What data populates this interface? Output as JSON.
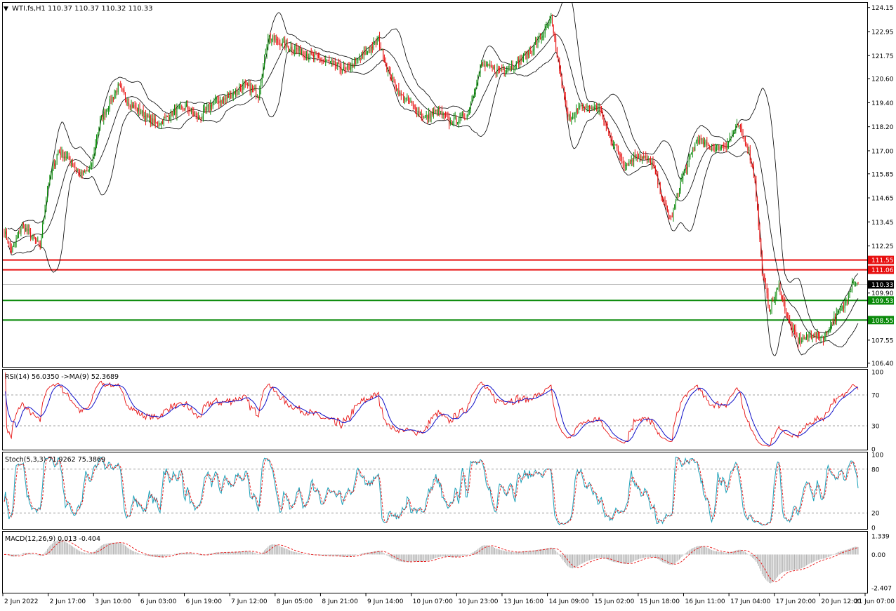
{
  "header": {
    "symbol": "WTI.fs,H1",
    "ohlc": "110.37 110.37 110.32 110.33"
  },
  "price_axis": {
    "ticks": [
      "124.15",
      "122.95",
      "121.75",
      "120.60",
      "119.40",
      "118.20",
      "117.00",
      "115.85",
      "114.65",
      "113.45",
      "112.25",
      "109.90",
      "107.55",
      "106.40"
    ],
    "tick_values": [
      124.15,
      122.95,
      121.75,
      120.6,
      119.4,
      118.2,
      117.0,
      115.85,
      114.65,
      113.45,
      112.25,
      109.9,
      107.55,
      106.4
    ],
    "range": [
      106.25,
      124.35
    ]
  },
  "levels": [
    {
      "label": "111.55",
      "value": 111.55,
      "color": "#e81010"
    },
    {
      "label": "111.06",
      "value": 111.06,
      "color": "#e81010"
    },
    {
      "label": "109.53",
      "value": 109.53,
      "color": "#0a8a0a"
    },
    {
      "label": "108.55",
      "value": 108.55,
      "color": "#0a8a0a"
    }
  ],
  "current_price": {
    "label": "110.33",
    "value": 110.33
  },
  "time_axis": [
    "2 Jun 2022",
    "2 Jun 17:00",
    "3 Jun 10:00",
    "6 Jun 03:00",
    "6 Jun 19:00",
    "7 Jun 12:00",
    "8 Jun 05:00",
    "8 Jun 21:00",
    "9 Jun 14:00",
    "10 Jun 07:00",
    "10 Jun 23:00",
    "13 Jun 16:00",
    "14 Jun 09:00",
    "15 Jun 02:00",
    "15 Jun 18:00",
    "16 Jun 11:00",
    "17 Jun 04:00",
    "17 Jun 20:00",
    "20 Jun 12:00",
    "21 Jun 07:00"
  ],
  "rsi": {
    "label": "RSI(14) 56.0350  ->MA(9) 52.3689",
    "ticks": [
      "100",
      "70",
      "30",
      "0"
    ],
    "tick_values": [
      100,
      70,
      30,
      0
    ]
  },
  "stoch": {
    "label": "Stoch(5,3,3) 71.9262 75.3869",
    "ticks": [
      "100",
      "80",
      "20",
      "0"
    ],
    "tick_values": [
      100,
      80,
      20,
      0
    ]
  },
  "macd": {
    "label": "MACD(12,26,9) 0.013 -0.404",
    "ticks": [
      "1.339",
      "0.00",
      "-2.407"
    ],
    "tick_values": [
      1.339,
      0,
      -2.407
    ]
  },
  "colors": {
    "bull": "#0a8a0a",
    "bear": "#e81010",
    "band": "#000000",
    "rsi": "#e81010",
    "rsi_ma": "#1010c8",
    "stoch_main": "#1aa0b8",
    "stoch_signal": "#e81010",
    "macd_hist": "#b0b0b0",
    "macd_signal": "#e81010",
    "current_price_tag": "#000000"
  },
  "chart_data": {
    "type": "candlestick",
    "symbol": "WTI.fs",
    "timeframe": "H1",
    "anchor_closes": [
      [
        0,
        113.0
      ],
      [
        6,
        112.0
      ],
      [
        15,
        113.3
      ],
      [
        30,
        112.2
      ],
      [
        36,
        115.2
      ],
      [
        45,
        117.0
      ],
      [
        55,
        116.5
      ],
      [
        64,
        115.8
      ],
      [
        72,
        116.1
      ],
      [
        80,
        118.5
      ],
      [
        95,
        120.2
      ],
      [
        104,
        119.4
      ],
      [
        118,
        118.7
      ],
      [
        128,
        118.3
      ],
      [
        140,
        118.9
      ],
      [
        152,
        119.2
      ],
      [
        162,
        118.6
      ],
      [
        174,
        119.4
      ],
      [
        185,
        119.6
      ],
      [
        200,
        120.3
      ],
      [
        212,
        119.8
      ],
      [
        220,
        122.7
      ],
      [
        232,
        122.3
      ],
      [
        246,
        122.0
      ],
      [
        258,
        121.7
      ],
      [
        272,
        121.4
      ],
      [
        285,
        121.0
      ],
      [
        300,
        121.8
      ],
      [
        312,
        122.5
      ],
      [
        320,
        121.0
      ],
      [
        330,
        119.8
      ],
      [
        340,
        119.3
      ],
      [
        350,
        118.6
      ],
      [
        362,
        119.0
      ],
      [
        372,
        118.4
      ],
      [
        386,
        118.8
      ],
      [
        398,
        121.3
      ],
      [
        410,
        121.0
      ],
      [
        424,
        121.2
      ],
      [
        436,
        121.8
      ],
      [
        448,
        122.7
      ],
      [
        456,
        123.5
      ],
      [
        462,
        121.4
      ],
      [
        470,
        118.6
      ],
      [
        482,
        119.2
      ],
      [
        496,
        119.1
      ],
      [
        506,
        117.6
      ],
      [
        518,
        116.3
      ],
      [
        528,
        116.8
      ],
      [
        540,
        116.4
      ],
      [
        550,
        114.4
      ],
      [
        556,
        113.6
      ],
      [
        566,
        115.8
      ],
      [
        578,
        117.6
      ],
      [
        590,
        117.1
      ],
      [
        602,
        117.3
      ],
      [
        612,
        118.3
      ],
      [
        620,
        117.2
      ],
      [
        626,
        115.6
      ],
      [
        632,
        111.0
      ],
      [
        638,
        109.1
      ],
      [
        646,
        110.2
      ],
      [
        654,
        108.5
      ],
      [
        662,
        107.5
      ],
      [
        674,
        107.8
      ],
      [
        684,
        107.7
      ],
      [
        692,
        108.6
      ],
      [
        700,
        109.2
      ],
      [
        708,
        110.6
      ],
      [
        712,
        110.33
      ]
    ],
    "rsi14": {
      "current": 56.035,
      "ma9": 52.3689,
      "levels": [
        70,
        30
      ]
    },
    "stoch": {
      "k": 71.9262,
      "d": 75.3869,
      "levels": [
        80,
        20
      ]
    },
    "macd": {
      "main": 0.013,
      "signal": -0.404
    }
  }
}
